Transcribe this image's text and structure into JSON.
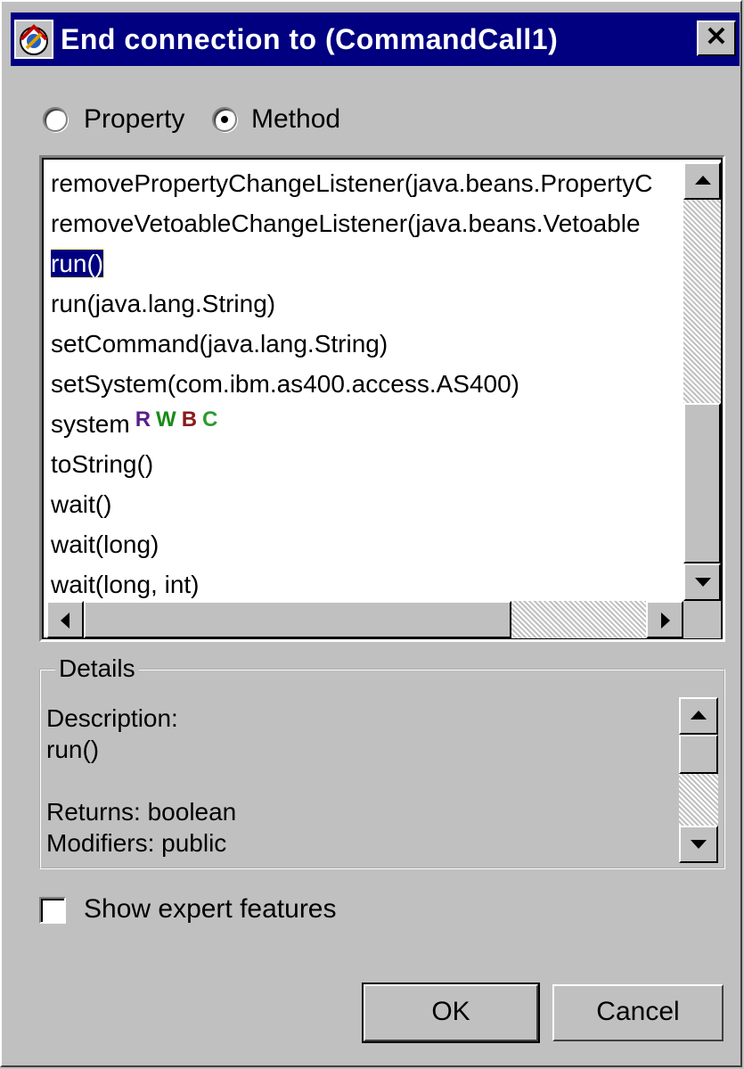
{
  "window": {
    "title": "End connection to (CommandCall1)",
    "close_label": "✕"
  },
  "mode": {
    "options": [
      {
        "label": "Property",
        "selected": false
      },
      {
        "label": "Method",
        "selected": true
      }
    ]
  },
  "methods": {
    "items": [
      {
        "label": "removePropertyChangeListener(java.beans.PropertyC",
        "selected": false
      },
      {
        "label": "removeVetoableChangeListener(java.beans.Vetoable",
        "selected": false
      },
      {
        "label": "run()",
        "selected": true
      },
      {
        "label": "run(java.lang.String)",
        "selected": false
      },
      {
        "label": "setCommand(java.lang.String)",
        "selected": false
      },
      {
        "label": "setSystem(com.ibm.as400.access.AS400)",
        "selected": false
      },
      {
        "label": "system",
        "selected": false,
        "badges": [
          "R",
          "W",
          "B",
          "C"
        ]
      },
      {
        "label": "toString()",
        "selected": false
      },
      {
        "label": "wait()",
        "selected": false
      },
      {
        "label": "wait(long)",
        "selected": false
      },
      {
        "label": "wait(long, int)",
        "selected": false
      }
    ],
    "badge_colors": {
      "R": "#5a1e8c",
      "W": "#1a8a1a",
      "B": "#8b1a1a",
      "C": "#2f9a2f"
    }
  },
  "details": {
    "title": "Details",
    "lines": [
      "Description:",
      "run()",
      "",
      "Returns: boolean",
      "Modifiers:  public"
    ]
  },
  "expert": {
    "label": "Show expert features",
    "checked": false
  },
  "buttons": {
    "ok": "OK",
    "cancel": "Cancel"
  },
  "colors": {
    "titlebar": "#000080",
    "selection": "#000080",
    "face": "#c0c0c0"
  }
}
